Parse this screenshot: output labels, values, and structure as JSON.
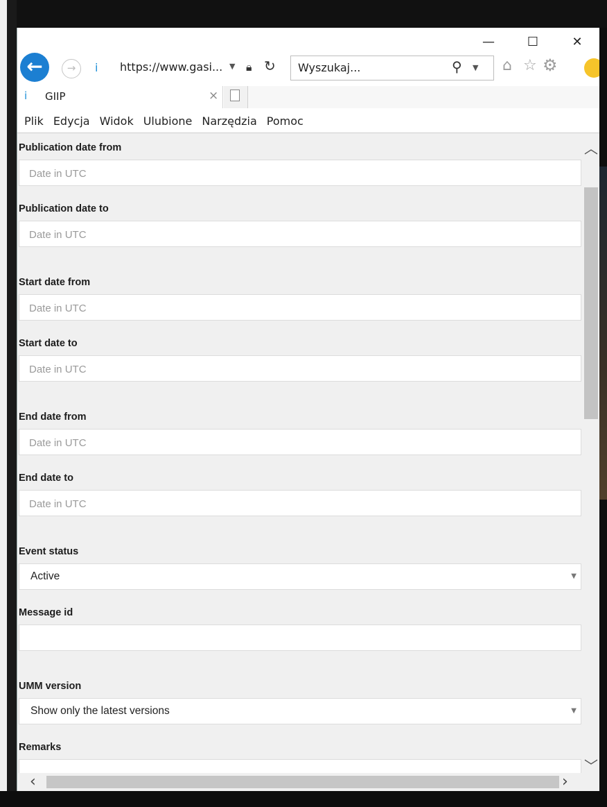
{
  "browser": {
    "url": "https://www.gasi...",
    "search_placeholder": "Wyszukaj...",
    "tab_title": "GIIP",
    "window_controls": {
      "minimize": "—",
      "maximize": "☐",
      "close": "✕"
    },
    "menu": [
      "Plik",
      "Edycja",
      "Widok",
      "Ulubione",
      "Narzędzia",
      "Pomoc"
    ]
  },
  "icons": {
    "back": "back-arrow-icon",
    "forward": "forward-arrow-icon",
    "site": "site-favicon",
    "lock": "lock-icon",
    "refresh": "refresh-icon",
    "search": "search-icon",
    "home": "home-icon",
    "favorites": "star-icon",
    "settings": "gear-icon",
    "feedback": "smiley-icon"
  },
  "form": {
    "fields": [
      {
        "label": "Publication date from",
        "type": "input",
        "placeholder": "Date in UTC",
        "value": ""
      },
      {
        "label": "Publication date to",
        "type": "input",
        "placeholder": "Date in UTC",
        "value": ""
      },
      {
        "label": "Start date from",
        "type": "input",
        "placeholder": "Date in UTC",
        "value": ""
      },
      {
        "label": "Start date to",
        "type": "input",
        "placeholder": "Date in UTC",
        "value": ""
      },
      {
        "label": "End date from",
        "type": "input",
        "placeholder": "Date in UTC",
        "value": ""
      },
      {
        "label": "End date to",
        "type": "input",
        "placeholder": "Date in UTC",
        "value": ""
      },
      {
        "label": "Event status",
        "type": "select",
        "value": "Active"
      },
      {
        "label": "Message id",
        "type": "input",
        "placeholder": "",
        "value": ""
      },
      {
        "label": "UMM version",
        "type": "select",
        "value": "Show only the latest versions"
      },
      {
        "label": "Remarks",
        "type": "input",
        "placeholder": "",
        "value": ""
      }
    ]
  },
  "colors": {
    "accent": "#1c7fd2",
    "content_bg": "#f0f0f0",
    "placeholder": "#9a9a9a"
  }
}
